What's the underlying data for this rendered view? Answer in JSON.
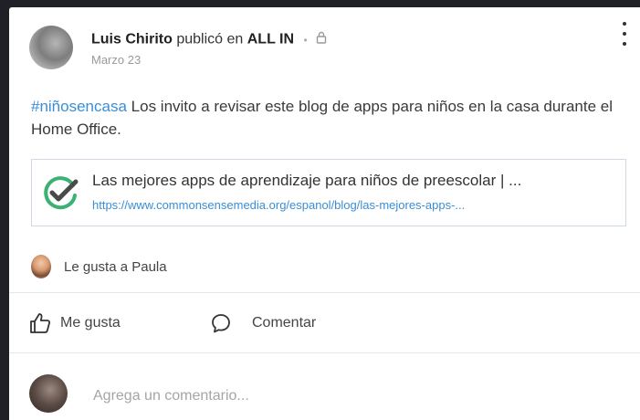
{
  "post": {
    "author": "Luis Chirito",
    "published_in": "publicó en",
    "community": "ALL IN",
    "date": "Marzo 23",
    "hashtag": "#niñosencasa",
    "body": "Los invito a revisar este blog de apps para niños en la casa durante el Home Office."
  },
  "link_preview": {
    "title": "Las mejores apps de aprendizaje para niños de preescolar | ...",
    "url": "https://www.commonsensemedia.org/espanol/blog/las-mejores-apps-..."
  },
  "likes": {
    "text": "Le gusta a Paula"
  },
  "actions": {
    "like_label": "Me gusta",
    "comment_label": "Comentar"
  },
  "comment": {
    "placeholder": "Agrega un comentario..."
  },
  "colors": {
    "link": "#3a8ed6",
    "check_green": "#3bb273",
    "check_dark": "#4a4a4a",
    "page_bg": "#1f2126"
  },
  "icons": [
    "lock-icon",
    "more-options-icon",
    "checkmark-logo-icon",
    "thumbs-up-icon",
    "comment-icon"
  ]
}
